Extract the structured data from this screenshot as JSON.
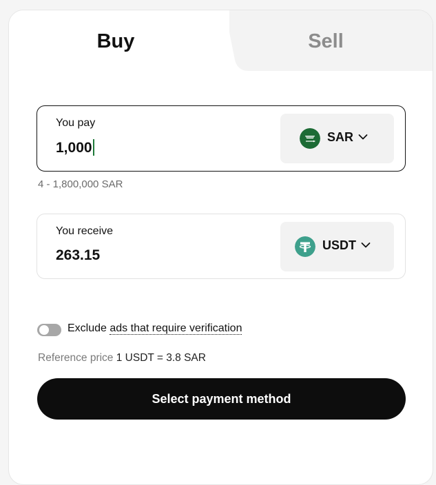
{
  "tabs": {
    "buy_label": "Buy",
    "sell_label": "Sell",
    "active": "Buy"
  },
  "pay": {
    "label": "You pay",
    "value": "1,000",
    "currency": "SAR",
    "currency_icon": "saudi-flag-icon",
    "range": "4 - 1,800,000 SAR"
  },
  "receive": {
    "label": "You receive",
    "value": "263.15",
    "currency": "USDT",
    "currency_icon": "tether-icon"
  },
  "filter": {
    "toggle_on": false,
    "label_prefix": "Exclude ",
    "label_link": "ads that require verification"
  },
  "reference": {
    "label": "Reference price",
    "value": "1 USDT = 3.8 SAR"
  },
  "cta": {
    "label": "Select payment method"
  },
  "colors": {
    "saudi_green": "#1d6b35",
    "tether_teal": "#3ea08c",
    "button_black": "#0d0d0d"
  }
}
